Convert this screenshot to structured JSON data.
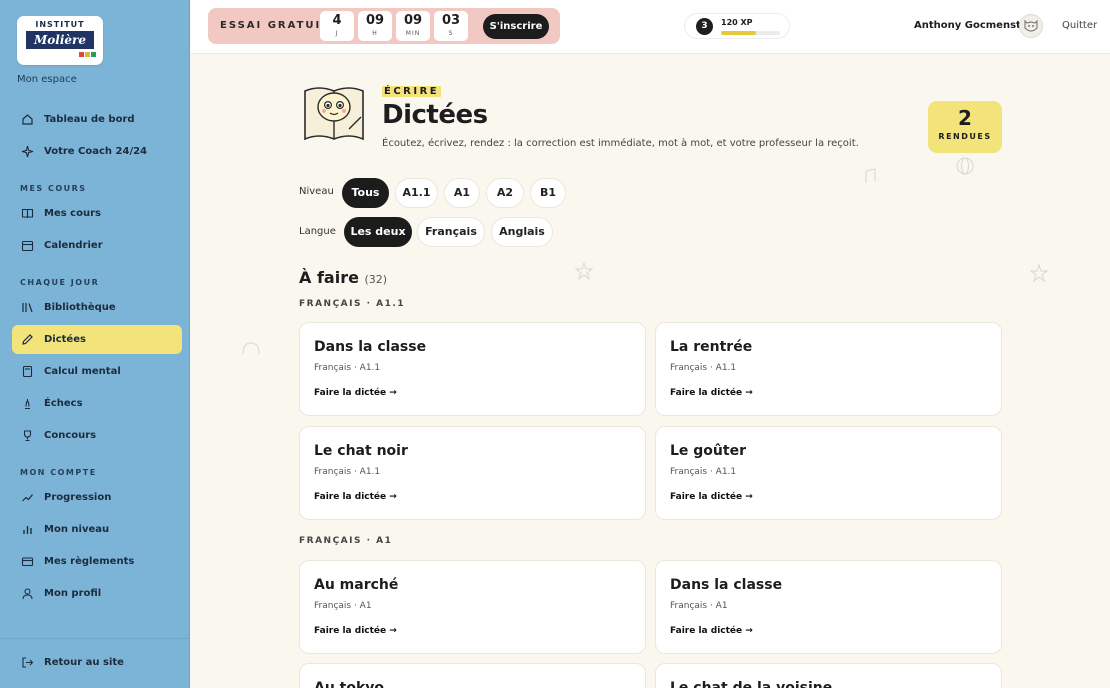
{
  "sidebar": {
    "logo": {
      "top": "INSTITUT",
      "main": "Molière"
    },
    "space_label": "Mon espace",
    "items_top": [
      {
        "label": "Tableau de bord",
        "icon": "home-icon"
      },
      {
        "label": "Votre Coach 24/24",
        "icon": "sparkle-icon"
      }
    ],
    "sections": [
      {
        "title": "MES COURS",
        "items": [
          {
            "label": "Mes cours",
            "icon": "book-icon"
          },
          {
            "label": "Calendrier",
            "icon": "calendar-icon"
          }
        ]
      },
      {
        "title": "CHAQUE JOUR",
        "items": [
          {
            "label": "Bibliothèque",
            "icon": "library-icon"
          },
          {
            "label": "Dictées",
            "icon": "pen-icon",
            "active": true
          },
          {
            "label": "Calcul mental",
            "icon": "calculator-icon"
          },
          {
            "label": "Échecs",
            "icon": "chess-icon"
          },
          {
            "label": "Concours",
            "icon": "trophy-icon"
          }
        ]
      },
      {
        "title": "MON COMPTE",
        "items": [
          {
            "label": "Progression",
            "icon": "chart-icon"
          },
          {
            "label": "Mon niveau",
            "icon": "bar-chart-icon"
          },
          {
            "label": "Mes règlements",
            "icon": "card-icon"
          },
          {
            "label": "Mon profil",
            "icon": "user-icon"
          }
        ]
      }
    ],
    "back_label": "Retour au site"
  },
  "topbar": {
    "trial_label": "ESSAI GRATUIT",
    "countdown": [
      {
        "value": "4",
        "unit": "J"
      },
      {
        "value": "09",
        "unit": "H"
      },
      {
        "value": "09",
        "unit": "MIN"
      },
      {
        "value": "03",
        "unit": "S"
      }
    ],
    "signup_label": "S'inscrire",
    "level": "3",
    "xp_label": "120 XP",
    "xp_progress": 0.6,
    "user_name": "Anthony Gocmenstd",
    "quit_label": "Quitter"
  },
  "header": {
    "kicker": "ÉCRIRE",
    "title": "Dictées",
    "subtitle": "Écoutez, écrivez, rendez : la correction est immédiate, mot à mot, et votre professeur la reçoit.",
    "rendues_count": "2",
    "rendues_label": "RENDUES"
  },
  "filters": {
    "level_label": "Niveau",
    "levels": [
      "Tous",
      "A1.1",
      "A1",
      "A2",
      "B1"
    ],
    "level_selected": "Tous",
    "language_label": "Langue",
    "languages": [
      "Les deux",
      "Français",
      "Anglais"
    ],
    "language_selected": "Les deux"
  },
  "todo": {
    "title": "À faire",
    "count": "(32)",
    "groups": [
      {
        "label": "FRANÇAIS · A1.1",
        "cards": [
          {
            "title": "Dans la classe",
            "meta": "Français · A1.1",
            "link": "Faire la dictée →"
          },
          {
            "title": "La rentrée",
            "meta": "Français · A1.1",
            "link": "Faire la dictée →"
          },
          {
            "title": "Le chat noir",
            "meta": "Français · A1.1",
            "link": "Faire la dictée →"
          },
          {
            "title": "Le goûter",
            "meta": "Français · A1.1",
            "link": "Faire la dictée →"
          }
        ]
      },
      {
        "label": "FRANÇAIS · A1",
        "cards": [
          {
            "title": "Au marché",
            "meta": "Français · A1",
            "link": "Faire la dictée →"
          },
          {
            "title": "Dans la classe",
            "meta": "Français · A1",
            "link": "Faire la dictée →"
          },
          {
            "title": "Au tokyo",
            "meta": "",
            "link": ""
          },
          {
            "title": "Le chat de la voisine",
            "meta": "",
            "link": ""
          }
        ]
      }
    ]
  },
  "colors": {
    "sidebar": "#7cb4d8",
    "accent": "#f2e37a",
    "trial": "#f2c9c2",
    "dark": "#1c1c1c"
  }
}
